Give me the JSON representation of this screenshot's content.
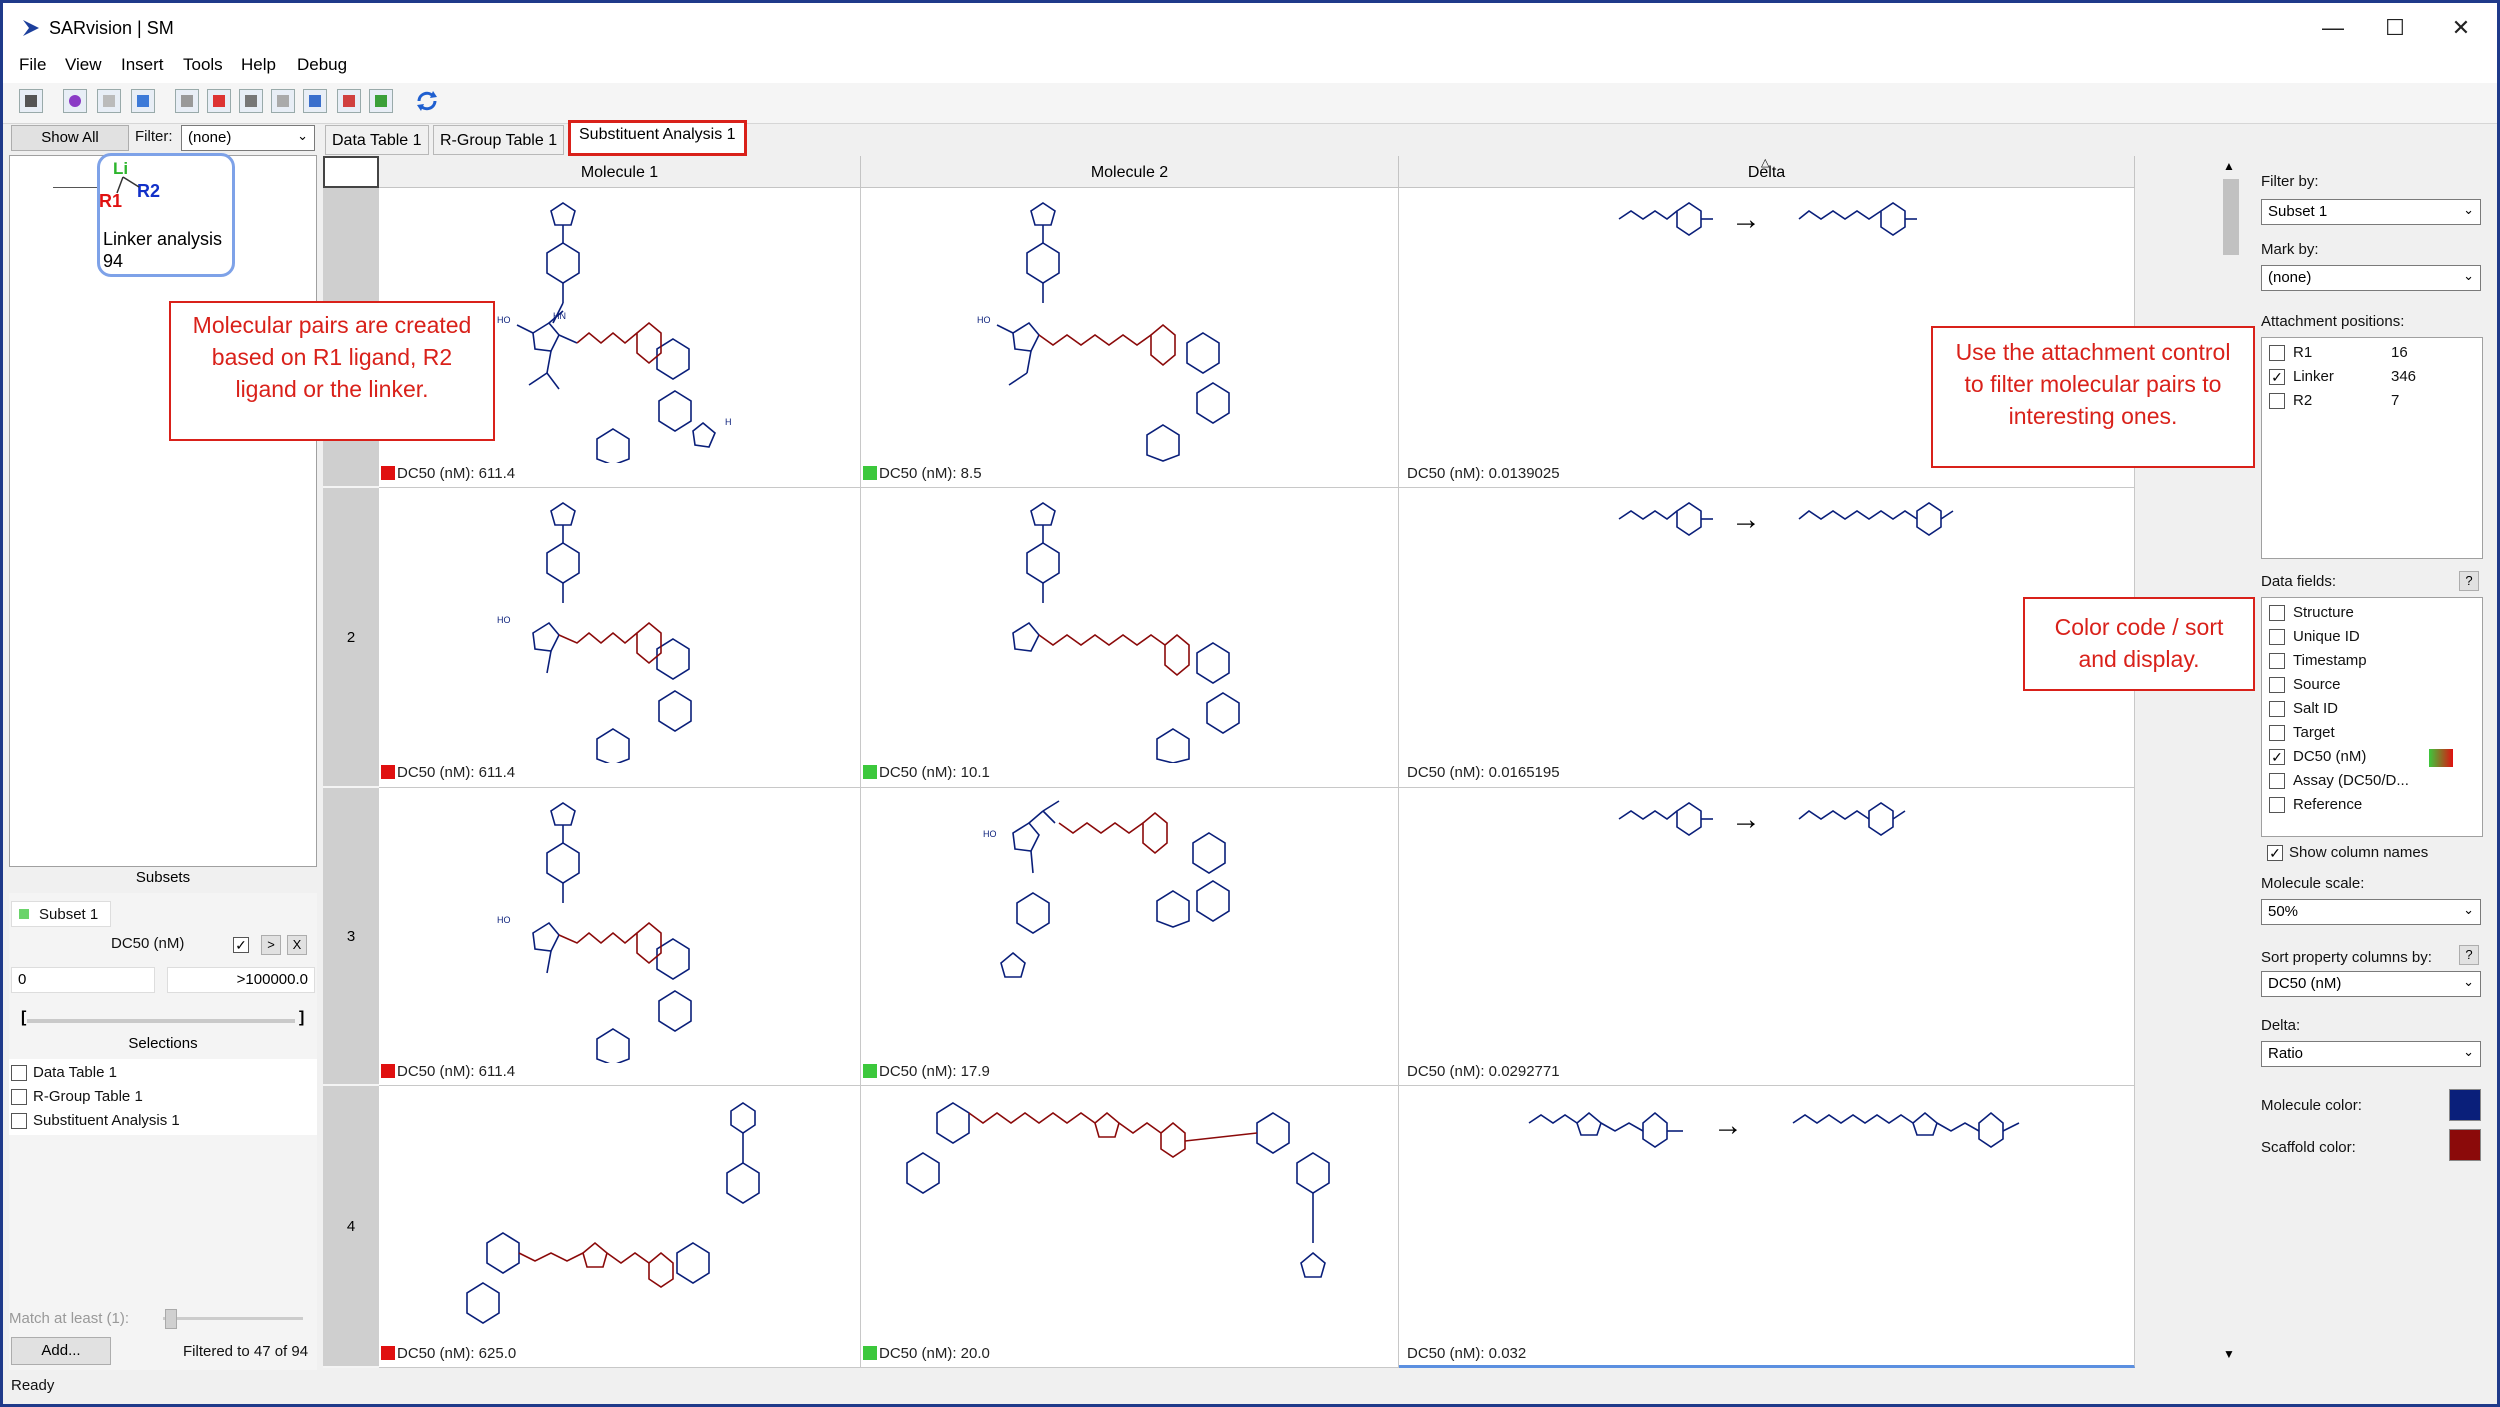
{
  "window": {
    "title": "SARvision | SM",
    "minimize": "—",
    "maximize": "☐",
    "close": "✕"
  },
  "menu": [
    "File",
    "View",
    "Insert",
    "Tools",
    "Help",
    "Debug"
  ],
  "toolbar": {
    "icons": [
      "sdf-icon",
      "search-molecule-icon",
      "table-icon",
      "rgroup-icon",
      "grid-icon",
      "rgroup-table-icon",
      "matrix-icon",
      "bar-chart-icon",
      "scatter-icon",
      "line-chart-icon",
      "refresh-icon"
    ]
  },
  "left": {
    "show_all": "Show All",
    "filter_label": "Filter:",
    "filter_value": "(none)",
    "node": {
      "li": "Li",
      "r1": "R1",
      "r2": "R2",
      "name": "Linker analysis",
      "count": "94"
    },
    "subsets_title": "Subsets",
    "subset_name": "Subset 1",
    "dc50_label": "DC50 (nM)",
    "range_min": "0",
    "range_max": ">100000.0",
    "bracket_left": "[",
    "bracket_right": "]",
    "selections_title": "Selections",
    "selections": [
      "Data Table 1",
      "R-Group Table 1",
      "Substituent Analysis 1"
    ],
    "match_label": "Match at least (1):",
    "add_button": "Add...",
    "filtered": "Filtered to 47 of 94"
  },
  "tabs": [
    "Data Table 1",
    "R-Group Table 1",
    "Substituent Analysis 1"
  ],
  "grid": {
    "columns": [
      "Molecule 1",
      "Molecule 2",
      "Delta"
    ],
    "rows": [
      {
        "num": "",
        "m1": "DC50 (nM): 611.4",
        "m2": "DC50 (nM): 8.5",
        "delta": "DC50 (nM): 0.0139025"
      },
      {
        "num": "2",
        "m1": "DC50 (nM): 611.4",
        "m2": "DC50 (nM): 10.1",
        "delta": "DC50 (nM): 0.0165195"
      },
      {
        "num": "3",
        "m1": "DC50 (nM): 611.4",
        "m2": "DC50 (nM): 17.9",
        "delta": "DC50 (nM): 0.0292771"
      },
      {
        "num": "4",
        "m1": "DC50 (nM): 625.0",
        "m2": "DC50 (nM): 20.0",
        "delta": "DC50 (nM): 0.032"
      }
    ]
  },
  "right": {
    "filter_by_label": "Filter by:",
    "filter_by_value": "Subset 1",
    "mark_by_label": "Mark by:",
    "mark_by_value": "(none)",
    "attach_label": "Attachment positions:",
    "attachments": [
      {
        "name": "R1",
        "count": "16",
        "checked": false
      },
      {
        "name": "Linker",
        "count": "346",
        "checked": true
      },
      {
        "name": "R2",
        "count": "7",
        "checked": false
      }
    ],
    "data_fields_label": "Data fields:",
    "help": "?",
    "fields": [
      {
        "name": "Structure",
        "checked": false
      },
      {
        "name": "Unique ID",
        "checked": false
      },
      {
        "name": "Timestamp",
        "checked": false
      },
      {
        "name": "Source",
        "checked": false
      },
      {
        "name": "Salt ID",
        "checked": false
      },
      {
        "name": "Target",
        "checked": false
      },
      {
        "name": "DC50 (nM)",
        "checked": true
      },
      {
        "name": "Assay (DC50/D...",
        "checked": false
      },
      {
        "name": "Reference",
        "checked": false
      }
    ],
    "show_col_names": "Show column names",
    "mol_scale_label": "Molecule scale:",
    "mol_scale_value": "50%",
    "sort_label": "Sort property columns by:",
    "sort_value": "DC50 (nM)",
    "delta_label": "Delta:",
    "delta_value": "Ratio",
    "mol_color_label": "Molecule color:",
    "scaffold_color_label": "Scaffold color:"
  },
  "callouts": {
    "pairs": "Molecular pairs are created based on R1 ligand, R2 ligand or the linker.",
    "attach": "Use the attachment control to filter molecular pairs to interesting ones.",
    "color": "Color code  / sort and display."
  },
  "status": "Ready",
  "colors": {
    "molecule": "#0a1f7a",
    "scaffold": "#8b0a0a",
    "bad": "#e01010",
    "good": "#3cc83c",
    "callout": "#d9211a",
    "frame": "#1f3a8a"
  }
}
